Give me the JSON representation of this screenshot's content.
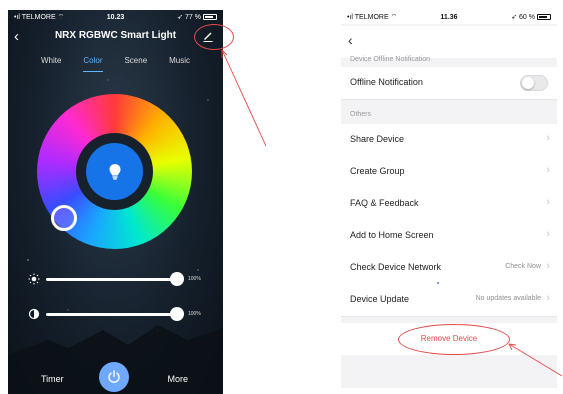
{
  "left_phone": {
    "status": {
      "carrier": "TELMORE",
      "time": "10.23",
      "battery": "77 %"
    },
    "title": "NRX RGBWC Smart Light",
    "tabs": [
      {
        "label": "White",
        "active": false
      },
      {
        "label": "Color",
        "active": true
      },
      {
        "label": "Scene",
        "active": false
      },
      {
        "label": "Music",
        "active": false
      }
    ],
    "brightness": {
      "value_label": "100%",
      "level": 1.0
    },
    "contrast": {
      "value_label": "100%",
      "level": 1.0
    },
    "bottom": {
      "timer_label": "Timer",
      "more_label": "More"
    },
    "icons": [
      "back-icon",
      "edit-pencil-icon",
      "bulb-icon",
      "sun-icon",
      "contrast-icon",
      "power-icon"
    ],
    "accent_color": "#5fb7ff",
    "center_color": "#1773e8"
  },
  "right_phone": {
    "status": {
      "carrier": "TELMORE",
      "time": "11.36",
      "battery": "60 %"
    },
    "sections": {
      "offline_title": "Device Offline Notification",
      "others_title": "Others"
    },
    "offline_notification": {
      "label": "Offline Notification",
      "enabled": false
    },
    "items": [
      {
        "label": "Share Device",
        "right": ""
      },
      {
        "label": "Create Group",
        "right": ""
      },
      {
        "label": "FAQ & Feedback",
        "right": ""
      },
      {
        "label": "Add to Home Screen",
        "right": ""
      },
      {
        "label": "Check Device Network",
        "right": "Check Now"
      },
      {
        "label": "Device Update",
        "right": "No updates available"
      }
    ],
    "remove_label": "Remove Device",
    "danger_color": "#e5484d"
  },
  "annotation_color": "#e54b4b"
}
